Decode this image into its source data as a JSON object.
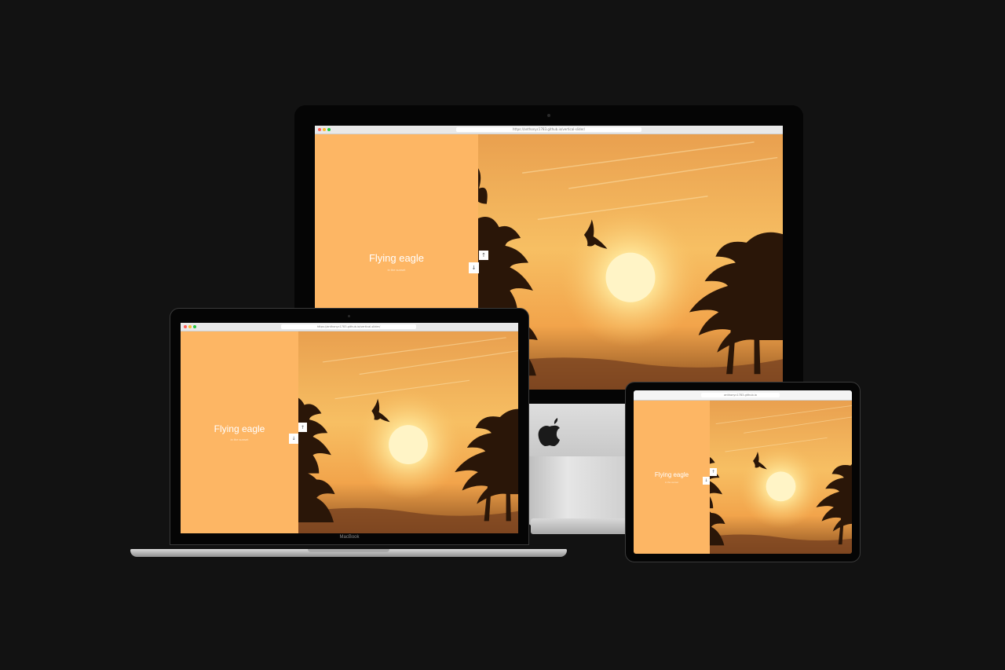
{
  "colors": {
    "background": "#121212",
    "panel": "#fdb664",
    "sky_top": "#e9a04f",
    "sky_mid": "#f8c46a",
    "sun": "#fff1b5",
    "silhouette": "#2a1608"
  },
  "slide": {
    "title": "Flying eagle",
    "subtitle": "in the sunset"
  },
  "browser": {
    "url_desktop": "https://anthonyc1783.github.io/vertical-slider/",
    "url_laptop": "https://anthonyc1783.github.io/vertical-slider/",
    "url_tablet": "anthonyc1783.github.io"
  },
  "controls": {
    "up_arrow": "↑",
    "down_arrow": "↓"
  },
  "devices": {
    "laptop_brand": "MacBook"
  },
  "icons": {
    "apple": "apple-logo-icon",
    "eagle": "eagle-icon"
  }
}
